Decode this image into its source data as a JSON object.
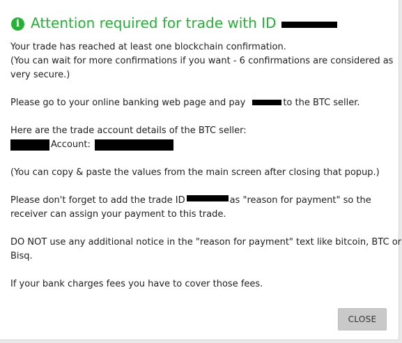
{
  "dialog": {
    "icon": "info-circle-icon",
    "title": "Attention required for trade with ID",
    "lines": {
      "confirmation": "Your trade has reached at least one blockchain confirmation.",
      "wait_1": "(You can wait for more confirmations if you want - 6 confirmations are considered as",
      "wait_2": "very secure.)",
      "pay_before": "Please go to your online banking web page and pay",
      "pay_after": "to the BTC seller.",
      "details": "Here are the trade account details of the BTC seller:",
      "account_label": "Account:",
      "copy_paste": "(You can copy & paste the values from the main screen after closing that popup.)",
      "reason_before": "Please don't forget to add the trade ID",
      "reason_after": "as \"reason for payment\" so the",
      "reason_2": "receiver can assign your payment to this trade.",
      "notice_1": "DO NOT use any additional notice in the \"reason for payment\" text like bitcoin, BTC or",
      "notice_2": "Bisq.",
      "fees": "If your bank charges fees you have to cover those fees."
    },
    "close_label": "CLOSE",
    "accent_color": "#25b135"
  }
}
